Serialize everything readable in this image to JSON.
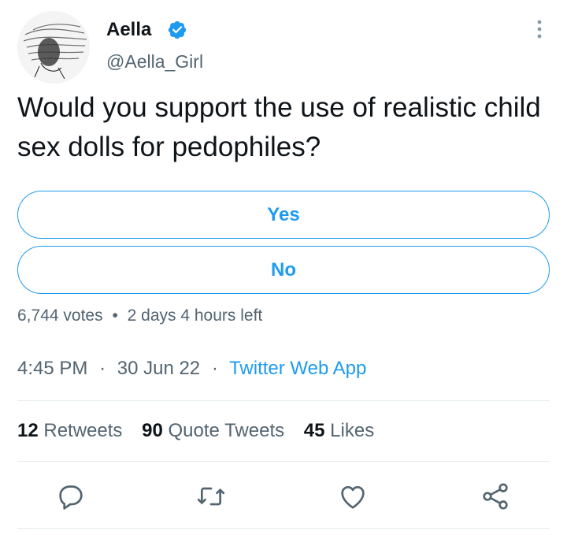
{
  "tweet": {
    "author": {
      "display_name": "Aella",
      "handle": "@Aella_Girl",
      "verified": true
    },
    "text": "Would you support the use of realistic child sex dolls for pedophiles?",
    "poll": {
      "options": [
        "Yes",
        "No"
      ],
      "votes": "6,744 votes",
      "separator": "•",
      "time_left": "2 days 4 hours left"
    },
    "time": "4:45 PM",
    "date": "30 Jun 22",
    "separator": "·",
    "source": "Twitter Web App",
    "stats": {
      "retweets_count": "12",
      "retweets_label": "Retweets",
      "quotes_count": "90",
      "quotes_label": "Quote Tweets",
      "likes_count": "45",
      "likes_label": "Likes"
    }
  },
  "colors": {
    "accent": "#1d9bf0",
    "secondary_text": "#536471",
    "primary_text": "#0f1419",
    "divider": "#e6ecf0"
  },
  "icons": {
    "verified": "verified-badge-icon",
    "more": "more-vertical-icon",
    "reply": "reply-icon",
    "retweet": "retweet-icon",
    "like": "heart-icon",
    "share": "share-icon"
  }
}
